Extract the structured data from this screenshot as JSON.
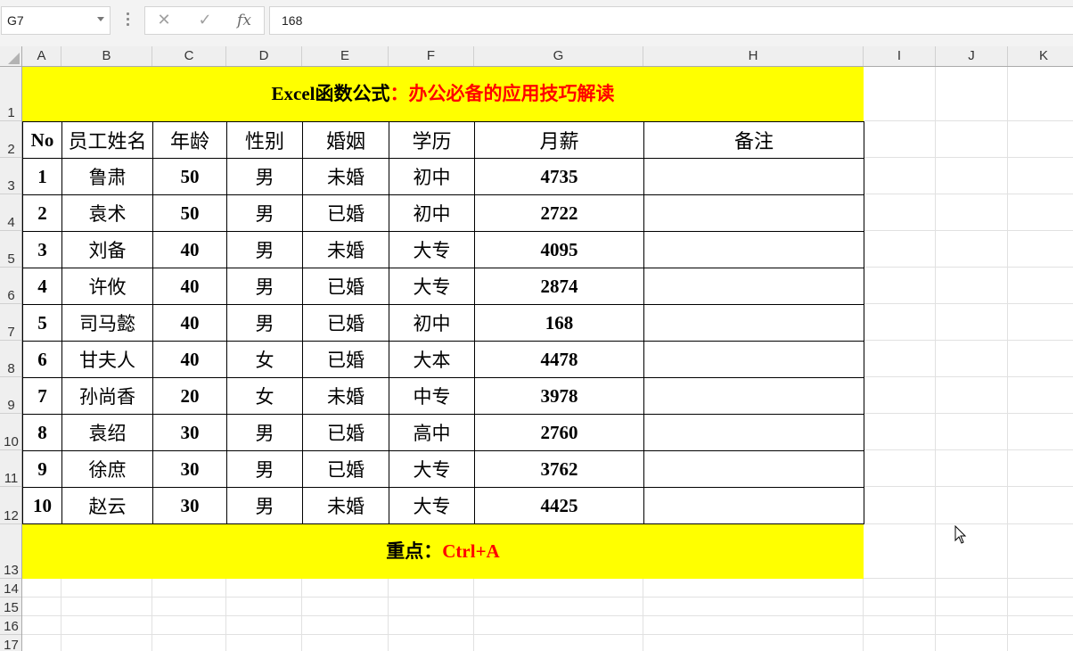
{
  "formula_bar": {
    "name_box": "G7",
    "cancel_icon": "close-icon",
    "enter_icon": "check-icon",
    "fx_label": "fx",
    "formula_value": "168"
  },
  "columns": [
    "A",
    "B",
    "C",
    "D",
    "E",
    "F",
    "G",
    "H",
    "I",
    "J",
    "K"
  ],
  "rows": [
    "1",
    "2",
    "3",
    "4",
    "5",
    "6",
    "7",
    "8",
    "9",
    "10",
    "11",
    "12",
    "13",
    "14",
    "15",
    "16",
    "17"
  ],
  "title_band": {
    "black_part": "Excel函数公式",
    "red_part": "：办公必备的应用技巧解读"
  },
  "table": {
    "headers": [
      "No",
      "员工姓名",
      "年龄",
      "性别",
      "婚姻",
      "学历",
      "月薪",
      "备注"
    ],
    "rows": [
      [
        "1",
        "鲁肃",
        "50",
        "男",
        "未婚",
        "初中",
        "4735",
        ""
      ],
      [
        "2",
        "袁术",
        "50",
        "男",
        "已婚",
        "初中",
        "2722",
        ""
      ],
      [
        "3",
        "刘备",
        "40",
        "男",
        "未婚",
        "大专",
        "4095",
        ""
      ],
      [
        "4",
        "许攸",
        "40",
        "男",
        "已婚",
        "大专",
        "2874",
        ""
      ],
      [
        "5",
        "司马懿",
        "40",
        "男",
        "已婚",
        "初中",
        "168",
        ""
      ],
      [
        "6",
        "甘夫人",
        "40",
        "女",
        "已婚",
        "大本",
        "4478",
        ""
      ],
      [
        "7",
        "孙尚香",
        "20",
        "女",
        "未婚",
        "中专",
        "3978",
        ""
      ],
      [
        "8",
        "袁绍",
        "30",
        "男",
        "已婚",
        "高中",
        "2760",
        ""
      ],
      [
        "9",
        "徐庶",
        "30",
        "男",
        "已婚",
        "大专",
        "3762",
        ""
      ],
      [
        "10",
        "赵云",
        "30",
        "男",
        "未婚",
        "大专",
        "4425",
        ""
      ]
    ]
  },
  "note_band": {
    "black_part": "重点：",
    "red_part": "Ctrl+A"
  },
  "colors": {
    "band_fill": "#ffff00",
    "accent_text": "#ff0000",
    "grid_line": "#e1e1e1",
    "header_bg": "#efefef"
  },
  "cursor_icon": "mouse-pointer-icon"
}
